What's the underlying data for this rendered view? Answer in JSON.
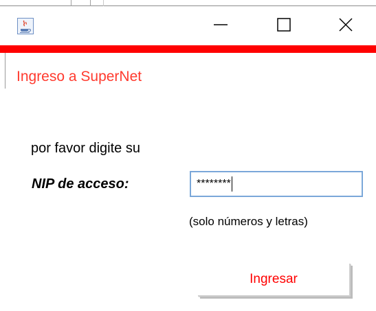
{
  "window": {
    "heading": "Ingreso a SuperNet",
    "accent_color": "#ff0000",
    "icons": {
      "app": "java-coffee-icon",
      "minimize": "minimize-icon",
      "maximize": "maximize-icon",
      "close": "close-icon"
    }
  },
  "form": {
    "prompt": "por favor digite su",
    "nip_label": "NIP de acceso:",
    "nip_value": "********",
    "hint": "(solo números y letras)",
    "submit_label": "Ingresar"
  }
}
